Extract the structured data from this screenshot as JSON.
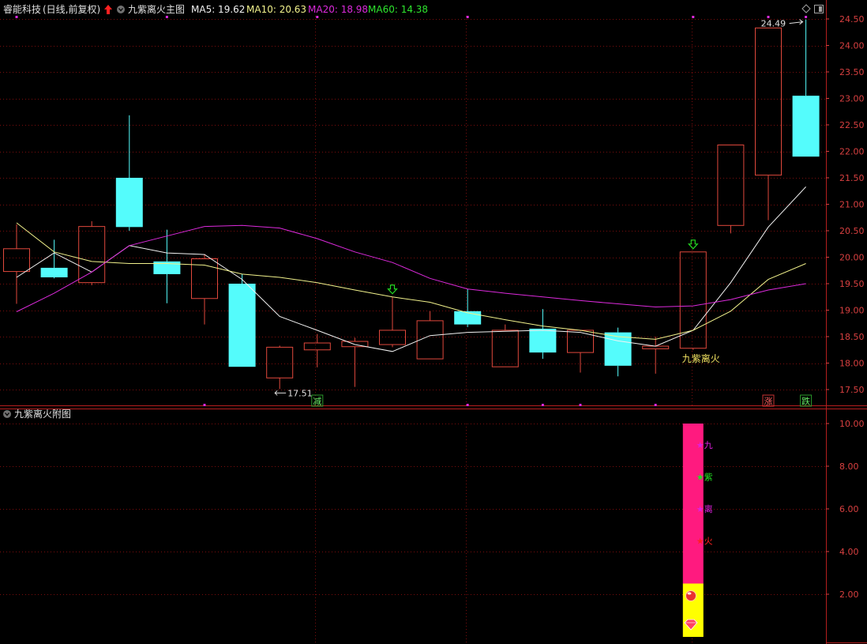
{
  "main_header": {
    "stock_name": "睿能科技",
    "period": "(日线,前复权)",
    "indicator_name": "九紫离火主图",
    "ma5": "MA5: 19.62",
    "ma10": "MA10: 20.63",
    "ma20": "MA20: 18.98",
    "ma60": "MA60: 14.38"
  },
  "sub_header": {
    "indicator_name": "九紫离火附图"
  },
  "colors": {
    "background": "#000000",
    "grid": "#7a0d0d",
    "axis_text": "#d84040",
    "up_candle": "#e0483c",
    "down_candle": "#54fcfc",
    "ma5": "#f2f2f2",
    "ma10": "#f2f28c",
    "ma20": "#dc2adc",
    "ma60": "#2ee62e",
    "header_text": "#e0e0e0",
    "signal_arrow": "#22d822",
    "label_yellow": "#f0e060",
    "sub_bar_pink": "#ff1a7f",
    "sub_bar_yellow": "#ffff00",
    "star_magenta": "#e020e0",
    "star_green": "#22e022",
    "star_red": "#ff2020",
    "badge_red": "#c83232",
    "badge_green": "#2a9a2a"
  },
  "icons": {
    "header_collapse": "circle-chevron-down-icon",
    "header_up_arrow": "red-up-arrow-icon",
    "top_right": [
      "diamond-icon",
      "window-toggle-icon"
    ],
    "signal": "hollow-down-arrow-icon",
    "sub_icons": [
      "red-ball-icon",
      "gem-icon"
    ]
  },
  "chart_data": [
    {
      "type": "candlestick",
      "ylim": [
        17.2,
        24.65
      ],
      "yticks": [
        "24.50",
        "24.00",
        "23.50",
        "23.00",
        "22.50",
        "22.00",
        "21.50",
        "21.00",
        "20.50",
        "20.00",
        "19.50",
        "19.00",
        "18.50",
        "18.00",
        "17.50"
      ],
      "candles": [
        {
          "o": 19.73,
          "h": 20.62,
          "l": 19.12,
          "c": 20.16
        },
        {
          "o": 19.8,
          "h": 20.33,
          "l": 19.6,
          "c": 19.62
        },
        {
          "o": 19.52,
          "h": 20.68,
          "l": 19.47,
          "c": 20.58
        },
        {
          "o": 21.5,
          "h": 22.68,
          "l": 20.5,
          "c": 20.57
        },
        {
          "o": 19.92,
          "h": 20.52,
          "l": 19.13,
          "c": 19.68
        },
        {
          "o": 19.22,
          "h": 20.06,
          "l": 18.73,
          "c": 19.97
        },
        {
          "o": 19.5,
          "h": 19.68,
          "l": 17.93,
          "c": 17.93
        },
        {
          "o": 17.72,
          "h": 18.33,
          "l": 17.51,
          "c": 18.3
        },
        {
          "o": 18.25,
          "h": 18.55,
          "l": 17.92,
          "c": 18.38
        },
        {
          "o": 18.31,
          "h": 18.48,
          "l": 17.55,
          "c": 18.41
        },
        {
          "o": 18.35,
          "h": 19.25,
          "l": 18.3,
          "c": 18.62
        },
        {
          "o": 18.08,
          "h": 18.98,
          "l": 18.08,
          "c": 18.8
        },
        {
          "o": 18.98,
          "h": 19.4,
          "l": 18.68,
          "c": 18.73
        },
        {
          "o": 17.93,
          "h": 18.73,
          "l": 17.93,
          "c": 18.62
        },
        {
          "o": 18.65,
          "h": 19.02,
          "l": 18.08,
          "c": 18.2
        },
        {
          "o": 18.2,
          "h": 18.6,
          "l": 17.82,
          "c": 18.62
        },
        {
          "o": 18.58,
          "h": 18.67,
          "l": 17.75,
          "c": 17.95
        },
        {
          "o": 18.27,
          "h": 18.5,
          "l": 17.8,
          "c": 18.32
        },
        {
          "o": 18.28,
          "h": 20.1,
          "l": 18.25,
          "c": 20.1
        },
        {
          "o": 20.6,
          "h": 22.12,
          "l": 20.45,
          "c": 22.12
        },
        {
          "o": 21.55,
          "h": 24.33,
          "l": 20.7,
          "c": 24.33
        },
        {
          "o": 23.05,
          "h": 24.49,
          "l": 21.9,
          "c": 21.9
        }
      ],
      "series": [
        {
          "name": "MA5",
          "values": [
            19.62,
            20.08,
            19.72,
            20.22,
            20.08,
            20.05,
            19.58,
            18.88,
            18.62,
            18.35,
            18.22,
            18.52,
            18.58,
            18.6,
            18.62,
            18.58,
            18.42,
            18.32,
            18.62,
            19.52,
            20.57,
            21.33
          ]
        },
        {
          "name": "MA10",
          "values": [
            20.65,
            20.1,
            19.92,
            19.88,
            19.88,
            19.85,
            19.68,
            19.62,
            19.52,
            19.38,
            19.25,
            19.15,
            18.95,
            18.82,
            18.7,
            18.62,
            18.5,
            18.45,
            18.62,
            18.98,
            19.58,
            19.88
          ]
        },
        {
          "name": "MA20",
          "values": [
            18.97,
            19.32,
            19.72,
            20.22,
            20.4,
            20.58,
            20.6,
            20.55,
            20.35,
            20.1,
            19.9,
            19.6,
            19.4,
            19.32,
            19.25,
            19.18,
            19.12,
            19.06,
            19.08,
            19.2,
            19.38,
            19.5
          ]
        }
      ],
      "annotations": [
        {
          "text": "17.51",
          "candle": 7,
          "value": 17.51,
          "kind": "low-price"
        },
        {
          "text": "24.49",
          "candle": 21,
          "value": 24.49,
          "kind": "high-price"
        },
        {
          "text": "九紫离火",
          "candle": 18,
          "value": 18.02,
          "kind": "signal-label"
        }
      ],
      "signal_arrows": [
        {
          "candle": 10,
          "value": 19.25
        },
        {
          "candle": 18,
          "value": 20.1
        }
      ],
      "badges": [
        {
          "text": "减",
          "candle": 8,
          "color": "green"
        },
        {
          "text": "涨",
          "candle": 20,
          "color": "red"
        },
        {
          "text": "跌",
          "candle": 21,
          "color": "green"
        }
      ],
      "top_markers": [
        0,
        4,
        8,
        12,
        18,
        20,
        21
      ],
      "bottom_markers": [
        5,
        12,
        14,
        15,
        17
      ]
    },
    {
      "type": "bar",
      "ylim": [
        0,
        10.4
      ],
      "yticks": [
        "10.00",
        "8.00",
        "6.00",
        "4.00",
        "2.00"
      ],
      "bars": [
        {
          "candle": 18,
          "bottom": 2.5,
          "top": 10.0,
          "color": "pink"
        },
        {
          "candle": 18,
          "bottom": 0.0,
          "top": 2.5,
          "color": "yellow"
        }
      ],
      "labels": [
        {
          "text": "★九",
          "value": 9.0,
          "color": "magenta"
        },
        {
          "text": "★紫",
          "value": 7.5,
          "color": "green"
        },
        {
          "text": "★离",
          "value": 6.0,
          "color": "magenta"
        },
        {
          "text": "★火",
          "value": 4.5,
          "color": "red"
        }
      ]
    }
  ]
}
